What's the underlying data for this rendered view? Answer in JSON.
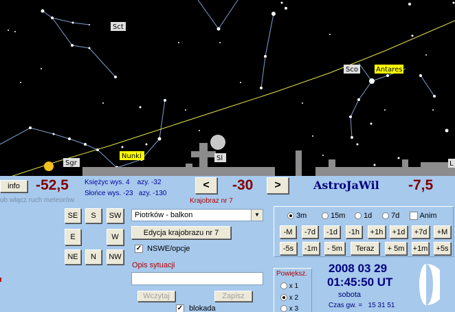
{
  "sky": {
    "constellations": [
      "Sct",
      "Sco",
      "Sgr",
      "Sl"
    ],
    "highlighted": [
      "Antares",
      "Nunki"
    ],
    "cut_label": "L",
    "colors": {
      "background": "#000000",
      "ecliptic": "#e6e64a",
      "highlight_bg": "#ffff00",
      "label_bg": "#e0e0e0"
    }
  },
  "info": {
    "button": "info",
    "azimuth_value": "-52,5",
    "moon_line": "Księżyc wys. 4    azy. -32",
    "sun_line": "Słońce wys. -23   azy. -130",
    "meteor_hint": "ub włącz ruch meteorów"
  },
  "nav": {
    "prev": "<",
    "value": "-30",
    "next": ">",
    "landscape_label": "Krajobraz nr 7",
    "app_title": "AstroJaWil",
    "right_value": "-7,5"
  },
  "directions": {
    "se": "SE",
    "s": "S",
    "sw": "SW",
    "e": "E",
    "w": "W",
    "ne": "NE",
    "n": "N",
    "nw": "NW"
  },
  "landscape": {
    "selected": "Piotrków - balkon",
    "edit_button": "Edycja krajobrazu nr 7",
    "nswe_label": "NSWE/opcje",
    "nswe_checked": true,
    "description_label": "Opis sytuacji",
    "description_value": "",
    "load_button": "Wczytaj",
    "save_button": "Zapisz",
    "lock_label": "blokada",
    "lock_checked": true
  },
  "time_step": {
    "options": [
      "3m",
      "15m",
      "1d",
      "7d"
    ],
    "selected": "3m",
    "anim_label": "Anim",
    "row1": [
      "-M",
      "-7d",
      "-1d",
      "-1h",
      "+1h",
      "+1d",
      "+7d",
      "+M"
    ],
    "row2": [
      "-5s",
      "-1m",
      "- 5m",
      "Teraz",
      "+ 5m",
      "+1m",
      "+5s"
    ]
  },
  "zoom": {
    "label": "Powiększ.",
    "options": [
      "x 1",
      "x 2",
      "x 3"
    ],
    "selected": "x 2"
  },
  "datetime": {
    "date": "2008 03 29",
    "time": "01:45:50 UT",
    "weekday": "sobota",
    "sidereal": "Czas gw. =   15 31 51"
  }
}
